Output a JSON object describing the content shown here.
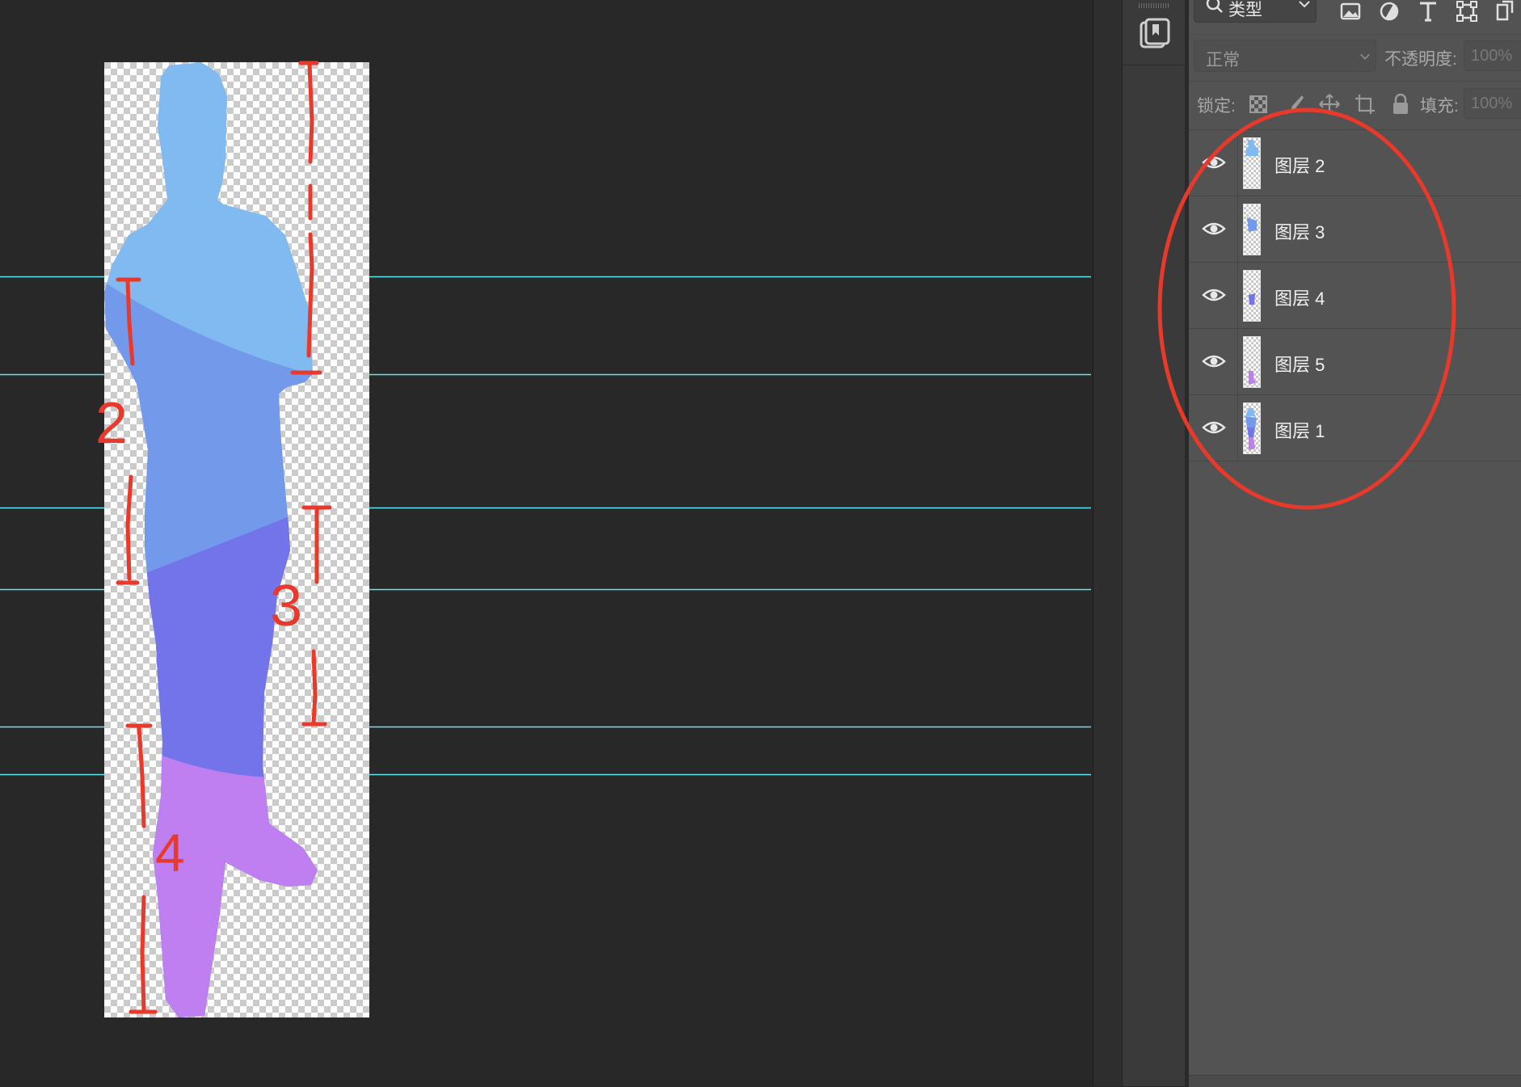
{
  "layers_panel": {
    "filter": {
      "label": "类型",
      "filter_icons": [
        "image-filter-icon",
        "adjustment-filter-icon",
        "type-filter-icon",
        "shape-filter-icon",
        "smart-object-filter-icon"
      ]
    },
    "blend_mode": "正常",
    "opacity_label": "不透明度:",
    "opacity_value": "100%",
    "lock_label": "锁定:",
    "lock_icons": [
      "lock-transparent-pixels-icon",
      "lock-image-pixels-icon",
      "lock-position-icon",
      "lock-artboard-icon",
      "lock-all-icon"
    ],
    "fill_label": "填充:",
    "fill_value": "100%",
    "layers": [
      {
        "name": "图层 2",
        "visible": true,
        "thumb": "upper-blue-part"
      },
      {
        "name": "图层 3",
        "visible": true,
        "thumb": "middle-blue-part"
      },
      {
        "name": "图层 4",
        "visible": true,
        "thumb": "indigo-part"
      },
      {
        "name": "图层 5",
        "visible": true,
        "thumb": "violet-part"
      },
      {
        "name": "图层 1",
        "visible": true,
        "thumb": "full-figure"
      }
    ]
  },
  "canvas": {
    "segment_labels": [
      "2",
      "3",
      "4"
    ],
    "segment_colors": [
      "#80baf0",
      "#7399ea",
      "#7474ea",
      "#c07ff0"
    ],
    "guide_color": "#5fe6f0",
    "annotation_color": "#e8392a"
  }
}
